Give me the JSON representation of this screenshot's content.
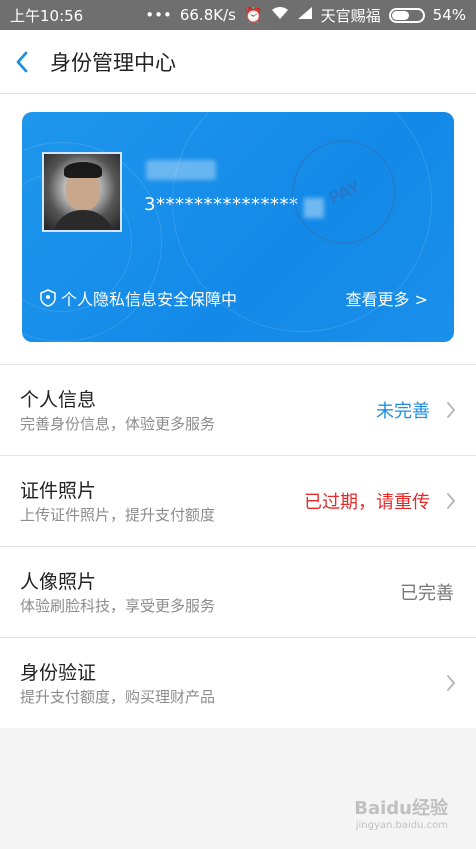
{
  "status_bar": {
    "time": "上午10:56",
    "speed": "66.8K/s",
    "carrier": "天官赐福",
    "battery": "54%"
  },
  "header": {
    "title": "身份管理中心"
  },
  "card": {
    "id_number": "3***************",
    "stamp_text": "PAY",
    "privacy_text": "个人隐私信息安全保障中",
    "see_more": "查看更多 >",
    "colors": {
      "card_bg": "#1f96ec"
    }
  },
  "items": [
    {
      "title": "个人信息",
      "subtitle": "完善身份信息，体验更多服务",
      "status": "未完善",
      "status_color": "#1e8fdf"
    },
    {
      "title": "证件照片",
      "subtitle": "上传证件照片，提升支付额度",
      "status": "已过期，请重传",
      "status_color": "#e52a2a"
    },
    {
      "title": "人像照片",
      "subtitle": "体验刷脸科技，享受更多服务",
      "status": "已完善",
      "status_color": "#777777"
    },
    {
      "title": "身份验证",
      "subtitle": "提升支付额度，购买理财产品",
      "status": "",
      "status_color": ""
    }
  ],
  "watermark": {
    "main": "Baidu经验",
    "sub": "jingyan.baidu.com"
  }
}
